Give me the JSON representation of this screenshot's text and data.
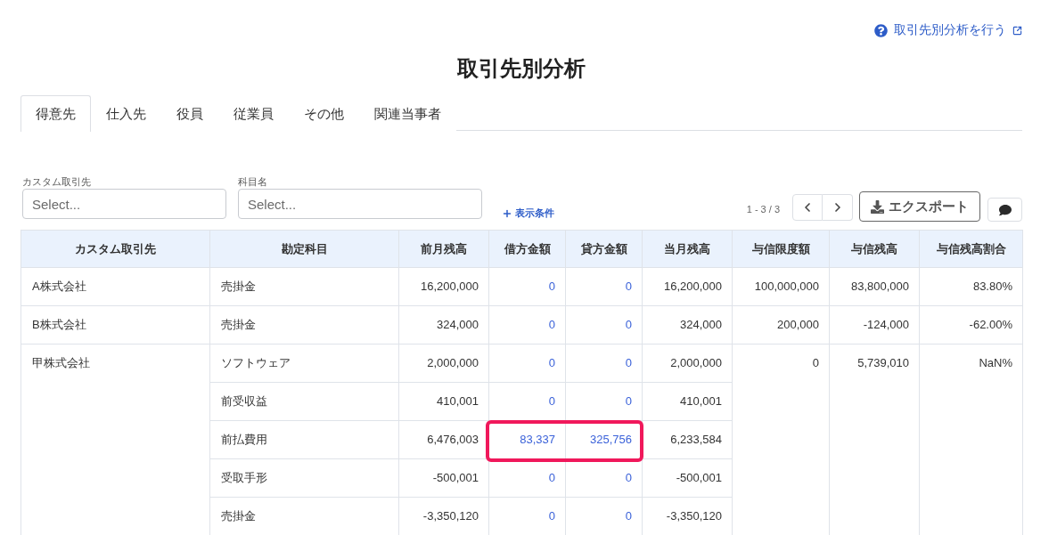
{
  "help_link": {
    "label": "取引先別分析を行う"
  },
  "title": "取引先別分析",
  "tabs": [
    {
      "label": "得意先",
      "selected": true
    },
    {
      "label": "仕入先",
      "selected": false
    },
    {
      "label": "役員",
      "selected": false
    },
    {
      "label": "従業員",
      "selected": false
    },
    {
      "label": "その他",
      "selected": false
    },
    {
      "label": "関連当事者",
      "selected": false
    }
  ],
  "filters": [
    {
      "label": "カスタム取引先",
      "placeholder": "Select..."
    },
    {
      "label": "科目名",
      "placeholder": "Select..."
    }
  ],
  "display_conditions_button": {
    "label": "表示条件"
  },
  "pagination": {
    "range": "1 - 3 / 3"
  },
  "export_button": {
    "label": "エクスポート"
  },
  "table": {
    "columns": [
      "カスタム取引先",
      "勘定科目",
      "前月残高",
      "借方金額",
      "貸方金額",
      "当月残高",
      "与信限度額",
      "与信残高",
      "与信残高割合"
    ],
    "groups": [
      {
        "customer": "A株式会社",
        "credit_limit": "100,000,000",
        "credit_balance": "83,800,000",
        "credit_ratio": "83.80%",
        "rows": [
          {
            "account": "売掛金",
            "prev_balance": "16,200,000",
            "debit": "0",
            "credit": "0",
            "current_balance": "16,200,000",
            "highlighted": false
          }
        ]
      },
      {
        "customer": "B株式会社",
        "credit_limit": "200,000",
        "credit_balance": "-124,000",
        "credit_ratio": "-62.00%",
        "rows": [
          {
            "account": "売掛金",
            "prev_balance": "324,000",
            "debit": "0",
            "credit": "0",
            "current_balance": "324,000",
            "highlighted": false
          }
        ]
      },
      {
        "customer": "甲株式会社",
        "credit_limit": "0",
        "credit_balance": "5,739,010",
        "credit_ratio": "NaN%",
        "rows": [
          {
            "account": "ソフトウェア",
            "prev_balance": "2,000,000",
            "debit": "0",
            "credit": "0",
            "current_balance": "2,000,000",
            "highlighted": false
          },
          {
            "account": "前受収益",
            "prev_balance": "410,001",
            "debit": "0",
            "credit": "0",
            "current_balance": "410,001",
            "highlighted": false
          },
          {
            "account": "前払費用",
            "prev_balance": "6,476,003",
            "debit": "83,337",
            "credit": "325,756",
            "current_balance": "6,233,584",
            "highlighted": true
          },
          {
            "account": "受取手形",
            "prev_balance": "-500,001",
            "debit": "0",
            "credit": "0",
            "current_balance": "-500,001",
            "highlighted": false
          },
          {
            "account": "売掛金",
            "prev_balance": "-3,350,120",
            "debit": "0",
            "credit": "0",
            "current_balance": "-3,350,120",
            "highlighted": false
          }
        ]
      }
    ]
  }
}
